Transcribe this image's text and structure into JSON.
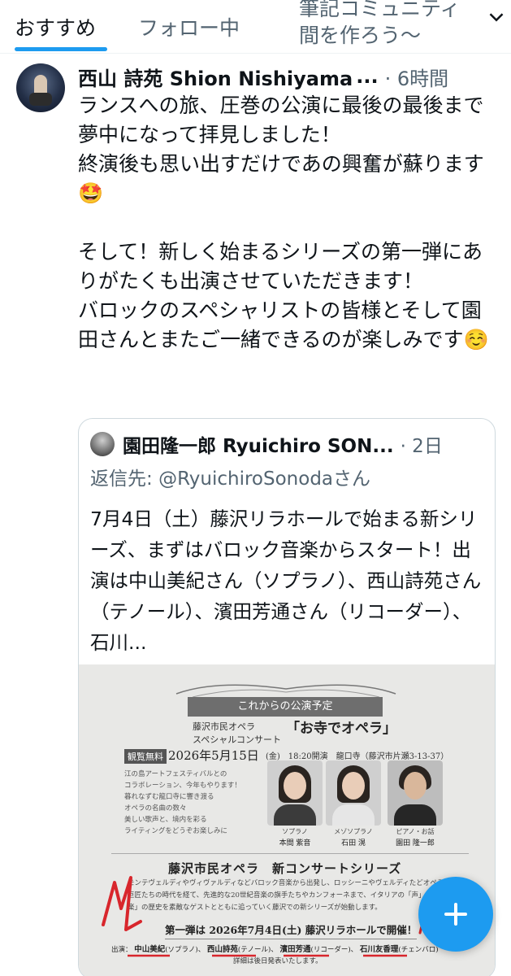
{
  "tabs": {
    "recommended": "おすすめ",
    "following": "フォロー中",
    "community_line1": "筆記コミュニティ",
    "community_line2": "間を作ろう〜"
  },
  "post": {
    "author_name": "西山 詩苑 Shion Nishiyama",
    "author_truncation": "...",
    "time": "· 6時間",
    "text": "ランスへの旅、圧巻の公演に最後の最後まで夢中になって拝見しました！\n終演後も思い出すだけであの興奮が蘇ります🤩\n\nそして！新しく始まるシリーズの第一弾にありがたくも出演させていただきます！\nバロックのスペシャリストの皆様とそして園田さんとまたご一緒できるのが楽しみです☺️"
  },
  "quote": {
    "author_name": "園田隆一郎 Ryuichiro SON...",
    "time": "· 2日",
    "reply_prefix": "返信先:",
    "reply_handle": "@RyuichiroSonodaさん",
    "text": "7月4日（土）藤沢リラホールで始まる新シリーズ、まずはバロック音楽からスタート！出演は中山美紀さん（ソプラノ）、西山詩苑さん（テノール）、濱田芳通さん（リコーダー）、石川..."
  },
  "flyer": {
    "upcoming": "これからの公演予定",
    "series_a": "藤沢市民オペラ",
    "series_b": "スペシャルコンサート",
    "concert_title": "「お寺でオペラ」",
    "free_badge": "観覧無料",
    "date": "2026年5月15日",
    "time_venue": "(金)　18:20開演　龍口寺（藤沢市片瀬3-13-37）",
    "blurb": "江の島アートフェスティバルとの\nコラボレーション、今年もやります！\n暮れなずむ龍口寺に響き渡る\nオペラの名曲の数々\n美しい歌声と、境内を彩る\nライティングをどうぞお楽しみに",
    "performers": [
      {
        "role": "ソプラノ",
        "name": "本間 紫音"
      },
      {
        "role": "メゾソプラノ",
        "name": "石田 滉"
      },
      {
        "role": "ピアノ・お話",
        "name": "園田 隆一郎"
      }
    ],
    "new_series": "藤沢市民オペラ　新コンサートシリーズ",
    "description": "モンテヴェルディやヴィヴァルディなどバロック音楽から出発し、ロッシーニやヴェルディたどオペラの巨匠たちの時代を経て、先進的な20世紀音楽の旗手たちやカンフォーネまで、イタリアの「声」と「音楽」の歴史を素敵なゲストとともに追っていく藤沢での新シリーズが始動します。",
    "first_installment": "第一弾は 2026年7月4日(土) 藤沢リラホールで開催！",
    "cast_prefix": "出演：",
    "cast": [
      {
        "name": "中山美紀",
        "role": "(ソプラノ)"
      },
      {
        "name": "西山詩苑",
        "role": "(テノール)"
      },
      {
        "name": "濱田芳通",
        "role": "(リコーダー)"
      },
      {
        "name": "石川友香理",
        "role": "(チェンバロ)"
      }
    ],
    "details_note": "詳細は後日発表いたします。"
  },
  "icons": {
    "settings": "gear-icon",
    "compose": "plus-icon"
  },
  "colors": {
    "accent": "#1d9bf0",
    "text_primary": "#0f1419",
    "text_secondary": "#536471",
    "annotation_red": "#d8262c"
  }
}
